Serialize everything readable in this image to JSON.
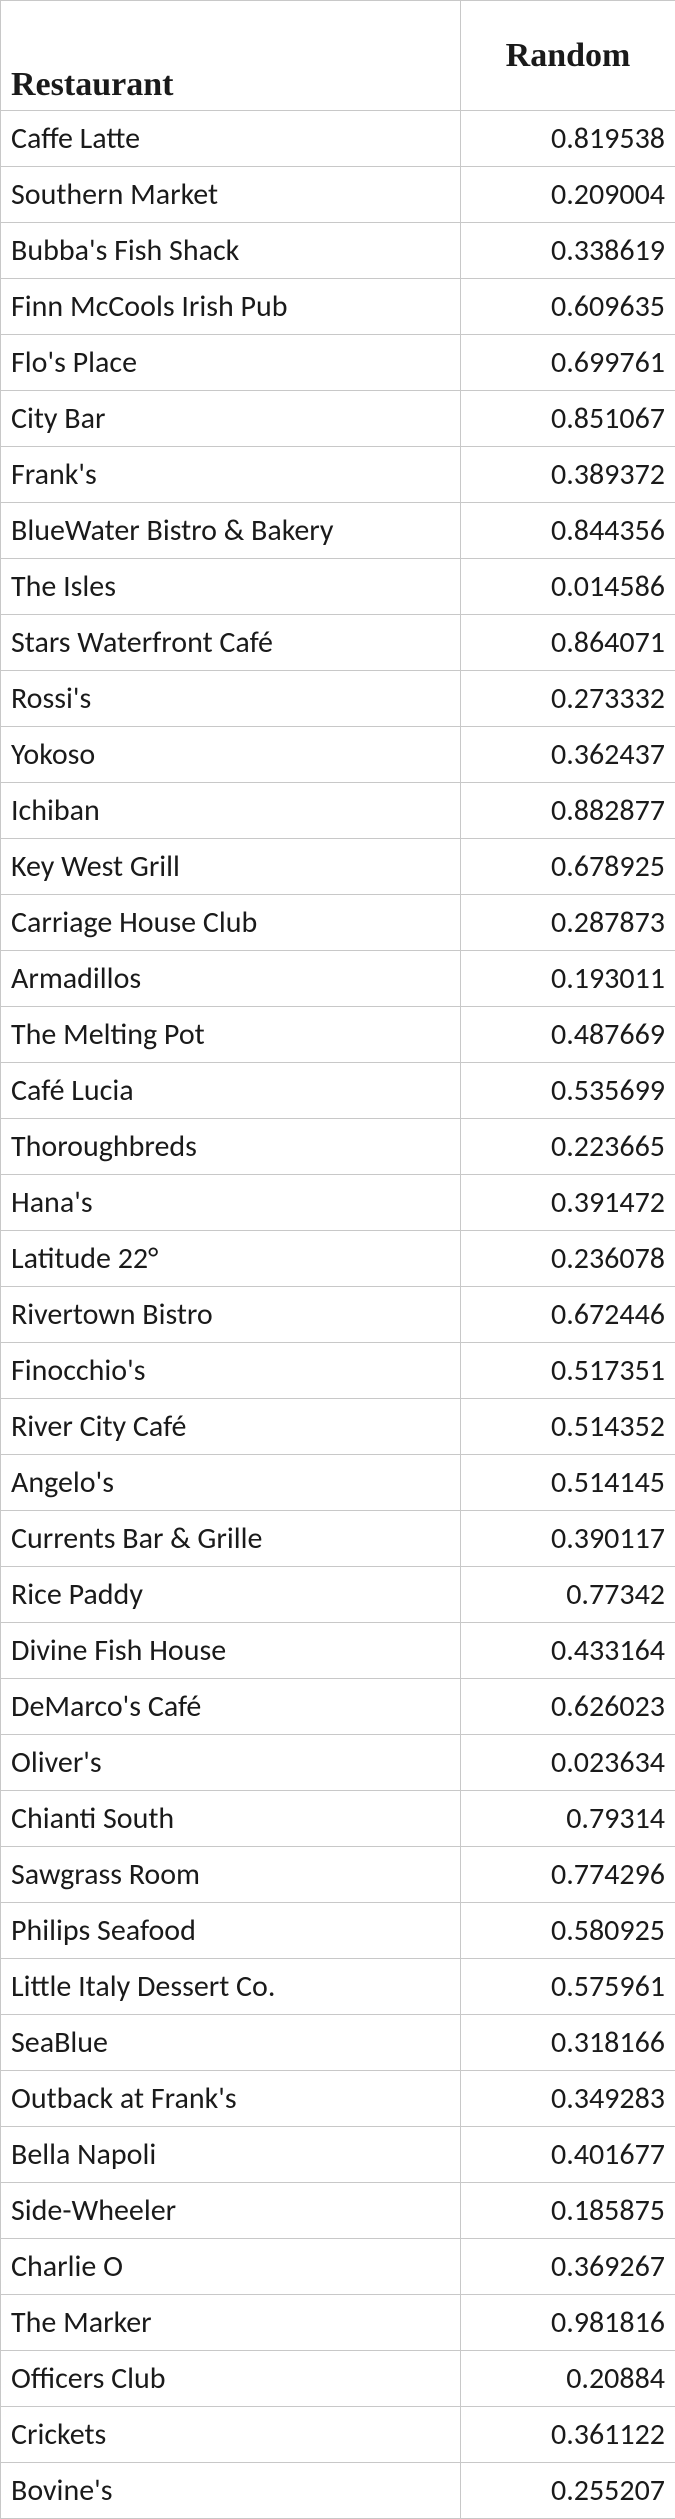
{
  "headers": {
    "c1": "Restaurant",
    "c2": "Random"
  },
  "rows": [
    {
      "name": "Caffe Latte",
      "value": "0.819538"
    },
    {
      "name": "Southern Market",
      "value": "0.209004"
    },
    {
      "name": "Bubba's Fish Shack",
      "value": "0.338619"
    },
    {
      "name": "Finn McCools Irish Pub",
      "value": "0.609635"
    },
    {
      "name": "Flo's Place",
      "value": "0.699761"
    },
    {
      "name": "City Bar",
      "value": "0.851067"
    },
    {
      "name": "Frank's",
      "value": "0.389372"
    },
    {
      "name": "BlueWater Bistro & Bakery",
      "value": "0.844356"
    },
    {
      "name": "The Isles",
      "value": "0.014586"
    },
    {
      "name": "Stars Waterfront Café",
      "value": "0.864071"
    },
    {
      "name": "Rossi's",
      "value": "0.273332"
    },
    {
      "name": "Yokoso",
      "value": "0.362437"
    },
    {
      "name": "Ichiban",
      "value": "0.882877"
    },
    {
      "name": "Key West Grill",
      "value": "0.678925"
    },
    {
      "name": "Carriage House Club",
      "value": "0.287873"
    },
    {
      "name": "Armadillos",
      "value": "0.193011"
    },
    {
      "name": "The Melting Pot",
      "value": "0.487669"
    },
    {
      "name": "Café Lucia",
      "value": "0.535699"
    },
    {
      "name": "Thoroughbreds",
      "value": "0.223665"
    },
    {
      "name": "Hana's",
      "value": "0.391472"
    },
    {
      "name": "Latitude 22°",
      "value": "0.236078"
    },
    {
      "name": "Rivertown Bistro",
      "value": "0.672446"
    },
    {
      "name": "Finocchio's",
      "value": "0.517351"
    },
    {
      "name": "River City Café",
      "value": "0.514352"
    },
    {
      "name": "Angelo's",
      "value": "0.514145"
    },
    {
      "name": "Currents Bar & Grille",
      "value": "0.390117"
    },
    {
      "name": "Rice Paddy",
      "value": "0.77342"
    },
    {
      "name": "Divine Fish House",
      "value": "0.433164"
    },
    {
      "name": "DeMarco's Café",
      "value": "0.626023"
    },
    {
      "name": "Oliver's",
      "value": "0.023634"
    },
    {
      "name": "Chianti South",
      "value": "0.79314"
    },
    {
      "name": "Sawgrass Room",
      "value": "0.774296"
    },
    {
      "name": "Philips Seafood",
      "value": "0.580925"
    },
    {
      "name": "Little Italy Dessert Co.",
      "value": "0.575961"
    },
    {
      "name": "SeaBlue",
      "value": "0.318166"
    },
    {
      "name": "Outback at Frank's",
      "value": "0.349283"
    },
    {
      "name": "Bella Napoli",
      "value": "0.401677"
    },
    {
      "name": "Side-Wheeler",
      "value": "0.185875"
    },
    {
      "name": "Charlie O",
      "value": "0.369267"
    },
    {
      "name": "The Marker",
      "value": "0.981816"
    },
    {
      "name": "Officers Club",
      "value": "0.20884"
    },
    {
      "name": "Crickets",
      "value": "0.361122"
    },
    {
      "name": "Bovine's",
      "value": "0.255207"
    }
  ]
}
